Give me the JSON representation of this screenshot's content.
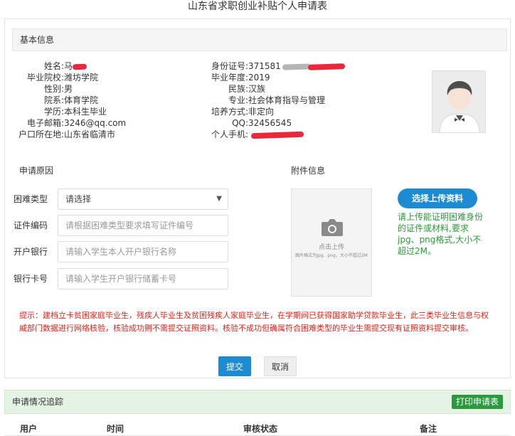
{
  "page_title": "山东省求职创业补贴个人申请表",
  "basic_info": {
    "section_title": "基本信息",
    "left": [
      {
        "label": "姓名:",
        "value": "马"
      },
      {
        "label": "毕业院校:",
        "value": "潍坊学院"
      },
      {
        "label": "性别:",
        "value": "男"
      },
      {
        "label": "院系:",
        "value": "体育学院"
      },
      {
        "label": "学历:",
        "value": "本科生毕业"
      },
      {
        "label": "电子邮箱:",
        "value": "3246@qq.com"
      },
      {
        "label": "户口所在地:",
        "value": "山东省临清市"
      }
    ],
    "right": [
      {
        "label": "身份证号:",
        "value": "371581"
      },
      {
        "label": "毕业年度:",
        "value": "2019"
      },
      {
        "label": "民族:",
        "value": "汉族"
      },
      {
        "label": "专业:",
        "value": "社会体育指导与管理"
      },
      {
        "label": "培养方式:",
        "value": "非定向"
      },
      {
        "label": "QQ:",
        "value": "32456545"
      },
      {
        "label": "个人手机:",
        "value": ""
      }
    ]
  },
  "application": {
    "reason_title": "申请原因",
    "attachment_title": "附件信息",
    "fields": [
      {
        "label": "困难类型",
        "value": "请选择"
      },
      {
        "label": "证件编码",
        "placeholder": "请根据困难类型要求填写证件编号"
      },
      {
        "label": "开户银行",
        "placeholder": "请输入学生本人开户银行名称"
      },
      {
        "label": "银行卡号",
        "placeholder": "请输入学生开户银行储蓄卡号"
      }
    ],
    "upload_box_text": "点击上传",
    "upload_box_subtext": "图片格式为jpg、png，大小不超过2M",
    "upload_button": "选择上传资料",
    "upload_tip": "请上传能证明困难身份的证件或材料,要求jpg、png格式,大小不超过2M。"
  },
  "hint": "提示：建档立卡贫困家庭毕业生，残疾人毕业生及贫困残疾人家庭毕业生，在学期间已获得国家助学贷款毕业生，此三类毕业生信息与权威部门数据进行网络核验，核验成功则不需提交证照资料。核验不成功但确属符合困难类型的毕业生需提交现有证照资料提交审核。",
  "buttons": {
    "submit": "提交",
    "cancel": "取消"
  },
  "tracking": {
    "title": "申请情况追踪",
    "print_button": "打印申请表",
    "columns": [
      "用户",
      "时间",
      "审核状态",
      "备注"
    ]
  },
  "colors": {
    "primary": "#1c8bd2",
    "danger": "#e1251b",
    "success": "#2b9a3f",
    "redact": "#e8283b"
  }
}
